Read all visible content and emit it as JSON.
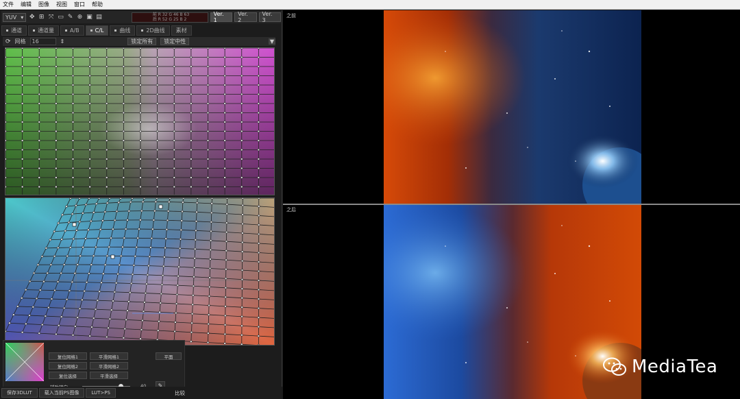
{
  "menu": [
    "文件",
    "编辑",
    "图像",
    "视图",
    "窗口",
    "帮助"
  ],
  "toolbar": {
    "mode_select": "YUV",
    "readout_lines": [
      "前  R 32 G 46 B 63",
      "后  R 52 G 25 B 2"
    ],
    "versions": [
      "Ver. 1",
      "Ver. 2",
      "Ver. 3"
    ]
  },
  "tabs": [
    "通道",
    "通道量",
    "A/B",
    "C/L",
    "曲线",
    "2D曲线",
    "素材"
  ],
  "gridbar": {
    "grid_label": "网格",
    "grid_value": "16",
    "lock_all": "锁定所有",
    "lock_neutral": "锁定中性"
  },
  "bottom": {
    "buttons": [
      "复位网格1",
      "平滑网格1",
      "复位网格2",
      "平滑网格2",
      "复位选择",
      "平滑选择",
      "平面"
    ],
    "slider_label": "辅助转向",
    "slider_value": "40"
  },
  "footer": {
    "buttons": [
      "保存3DLUT",
      "载入当前PS图像",
      "LUT>PS"
    ],
    "compare": "比较"
  },
  "preview": {
    "before_label": "之前",
    "after_label": "之后"
  },
  "watermark": {
    "text": "MediaTea"
  }
}
